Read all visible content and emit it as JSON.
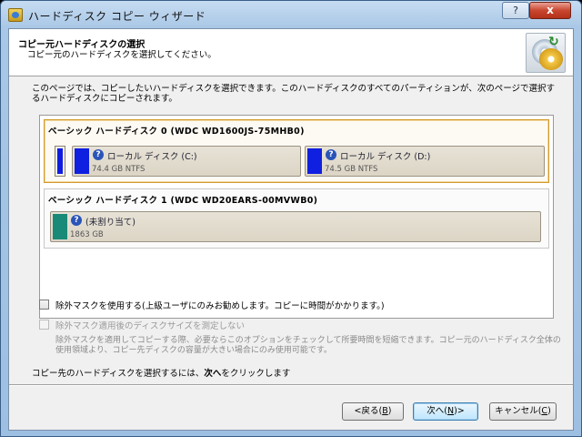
{
  "window": {
    "title": "ハードディスク コピー ウィザード",
    "help_label": "?",
    "close_label": "x"
  },
  "header": {
    "title": "コピー元ハードディスクの選択",
    "subtitle": "コピー元のハードディスクを選択してください。"
  },
  "description": "このページでは、コピーしたいハードディスクを選択できます。このハードディスクのすべてのパーティションが、次のページで選択するハードディスクにコピーされます。",
  "disks": [
    {
      "label": "ベーシック ハードディスク 0 (WDC WD1600JS-75MHB0)",
      "selected": true,
      "partitions": [
        {
          "name": "ローカル ディスク (C:)",
          "size": "74.4 GB NTFS",
          "color": "#1020e0"
        },
        {
          "name": "ローカル ディスク (D:)",
          "size": "74.5 GB NTFS",
          "color": "#1020e0"
        }
      ]
    },
    {
      "label": "ベーシック ハードディスク 1 (WDC WD20EARS-00MVWB0)",
      "selected": false,
      "partitions": [
        {
          "name": "(未割り当て)",
          "size": "1863 GB",
          "color": "#1a8a78"
        }
      ]
    }
  ],
  "options": {
    "exclusion_mask": {
      "label": "除外マスクを使用する(上級ユーザにのみお勧めします。コピーに時間がかかります。)",
      "checked": false
    },
    "measure_size": {
      "label": "除外マスク適用後のディスクサイズを測定しない",
      "checked": false,
      "disabled": true
    },
    "note": "除外マスクを適用してコピーする際、必要ならこのオプションをチェックして所要時間を短縮できます。コピー元のハードディスク全体の使用領域より、コピー先ディスクの容量が大きい場合にのみ使用可能です。"
  },
  "footer": {
    "instruction_pre": "コピー先のハードディスクを選択するには、",
    "instruction_bold": "次へ",
    "instruction_post": "をクリックします"
  },
  "buttons": {
    "back": {
      "label": "<戻る(",
      "key": "B",
      "suffix": ")"
    },
    "next": {
      "label": "次へ(",
      "key": "N",
      "suffix": ")>"
    },
    "cancel": {
      "label": "キャンセル(",
      "key": "C",
      "suffix": ")"
    }
  }
}
